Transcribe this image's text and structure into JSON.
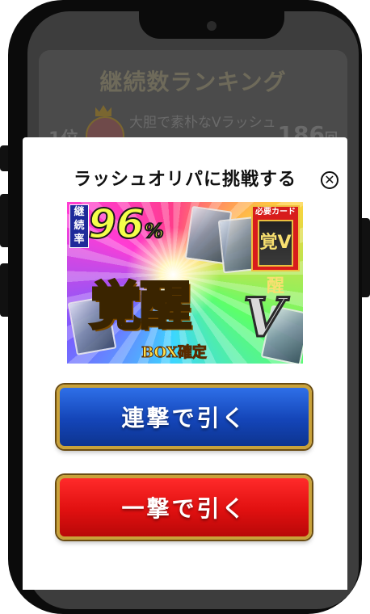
{
  "ranking": {
    "title": "継続数ランキング",
    "entry": {
      "position": "1位",
      "name": "大胆で素朴なVラッシュ王",
      "count": "186",
      "count_unit": "回"
    }
  },
  "modal": {
    "title": "ラッシュオリパに挑戦する",
    "close_icon": "close-icon",
    "banner": {
      "rate_label": "継続率",
      "rate_value": "96",
      "rate_unit": "%",
      "must_label": "必要カード",
      "must_card_text": "覚V醒",
      "main_text": "覚醒",
      "v_text": "V",
      "box_text": "BOX確定"
    },
    "buttons": {
      "multi_label": "連撃で引く",
      "single_label": "一撃で引く"
    }
  },
  "colors": {
    "blue_button": "#1445b8",
    "red_button": "#e01010",
    "gold_border": "#c9a23a"
  }
}
